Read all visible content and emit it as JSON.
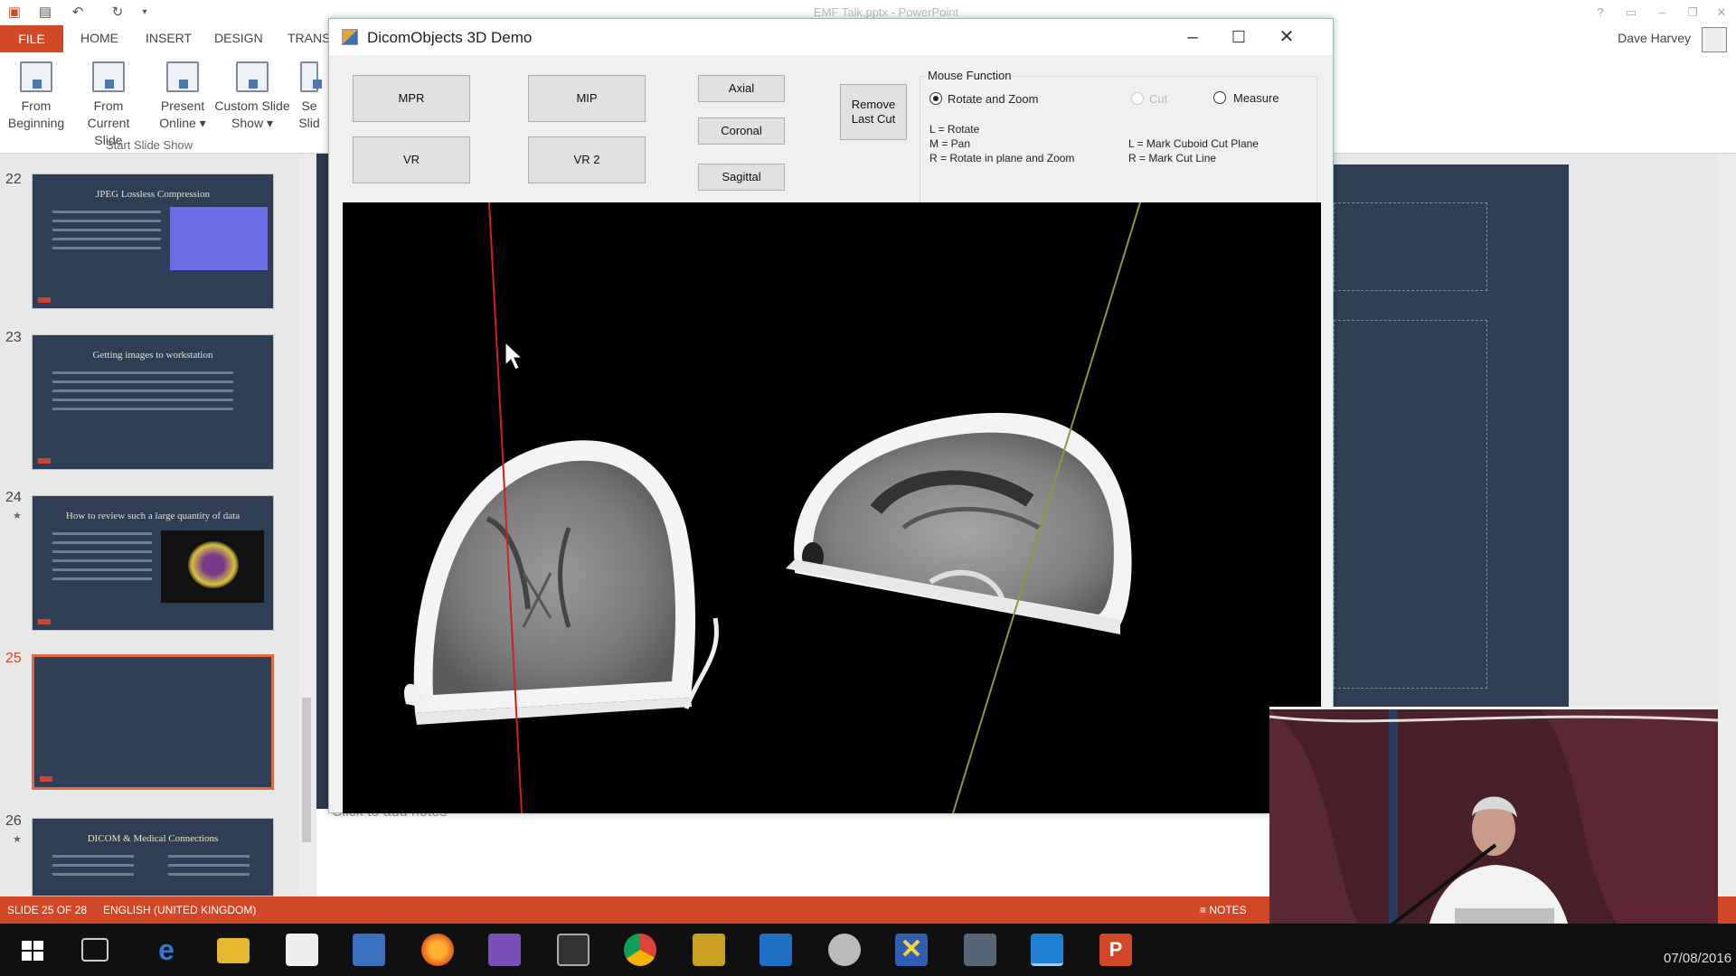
{
  "ppt": {
    "title": "EMF Talk.pptx - PowerPoint",
    "tabs": [
      "FILE",
      "HOME",
      "INSERT",
      "DESIGN",
      "TRANS"
    ],
    "user": "Dave Harvey",
    "ribbon": {
      "buttons": [
        {
          "label1": "From",
          "label2": "Beginning"
        },
        {
          "label1": "From",
          "label2": "Current Slide"
        },
        {
          "label1": "Present",
          "label2": "Online ▾"
        },
        {
          "label1": "Custom Slide",
          "label2": "Show ▾"
        },
        {
          "label1": "Se",
          "label2": "Slid"
        }
      ],
      "group_label": "Start Slide Show"
    },
    "thumbnails": [
      {
        "number": "22",
        "title": "JPEG Lossless Compression",
        "starred": false
      },
      {
        "number": "23",
        "title": "Getting images to workstation",
        "starred": false
      },
      {
        "number": "24",
        "title": "How to review such a large quantity of data",
        "starred": true
      },
      {
        "number": "25",
        "title": "",
        "starred": false
      },
      {
        "number": "26",
        "title": "DICOM & Medical Connections",
        "starred": true
      }
    ],
    "star_glyph": "★",
    "notes_placeholder": "Click to add notes",
    "status": {
      "slide": "SLIDE 25 OF 28",
      "language": "ENGLISH (UNITED KINGDOM)",
      "notes": "NOTES"
    }
  },
  "dicom": {
    "title": "DicomObjects 3D Demo",
    "buttons": {
      "mpr": "MPR",
      "mip": "MIP",
      "vr": "VR",
      "vr2": "VR 2",
      "axial": "Axial",
      "coronal": "Coronal",
      "sagittal": "Sagittal",
      "remove_cut_1": "Remove",
      "remove_cut_2": "Last Cut"
    },
    "mouse_function": {
      "legend": "Mouse Function",
      "options": [
        {
          "label": "Rotate and Zoom",
          "checked": true,
          "disabled": false
        },
        {
          "label": "Cut",
          "checked": false,
          "disabled": true
        },
        {
          "label": "Measure",
          "checked": false,
          "disabled": false
        }
      ],
      "help_left": [
        "L = Rotate",
        "M = Pan",
        "R = Rotate in plane and Zoom"
      ],
      "help_right": [
        "L = Mark Cuboid Cut Plane",
        "R = Mark Cut Line"
      ]
    }
  },
  "taskbar": {
    "date": "07/08/2016",
    "icons": [
      "windows-start",
      "task-view",
      "edge",
      "file-explorer",
      "store",
      "remote-desktop",
      "firefox",
      "visual-studio",
      "terminal",
      "chrome",
      "tools",
      "outlook",
      "paint",
      "xmind",
      "network",
      "active-window",
      "powerpoint"
    ]
  },
  "colors": {
    "ppt_accent": "#d24726",
    "slide_bg": "#2e3f55",
    "red_cut_line": "#d02020",
    "green_cut_line": "#8a9a3a"
  }
}
